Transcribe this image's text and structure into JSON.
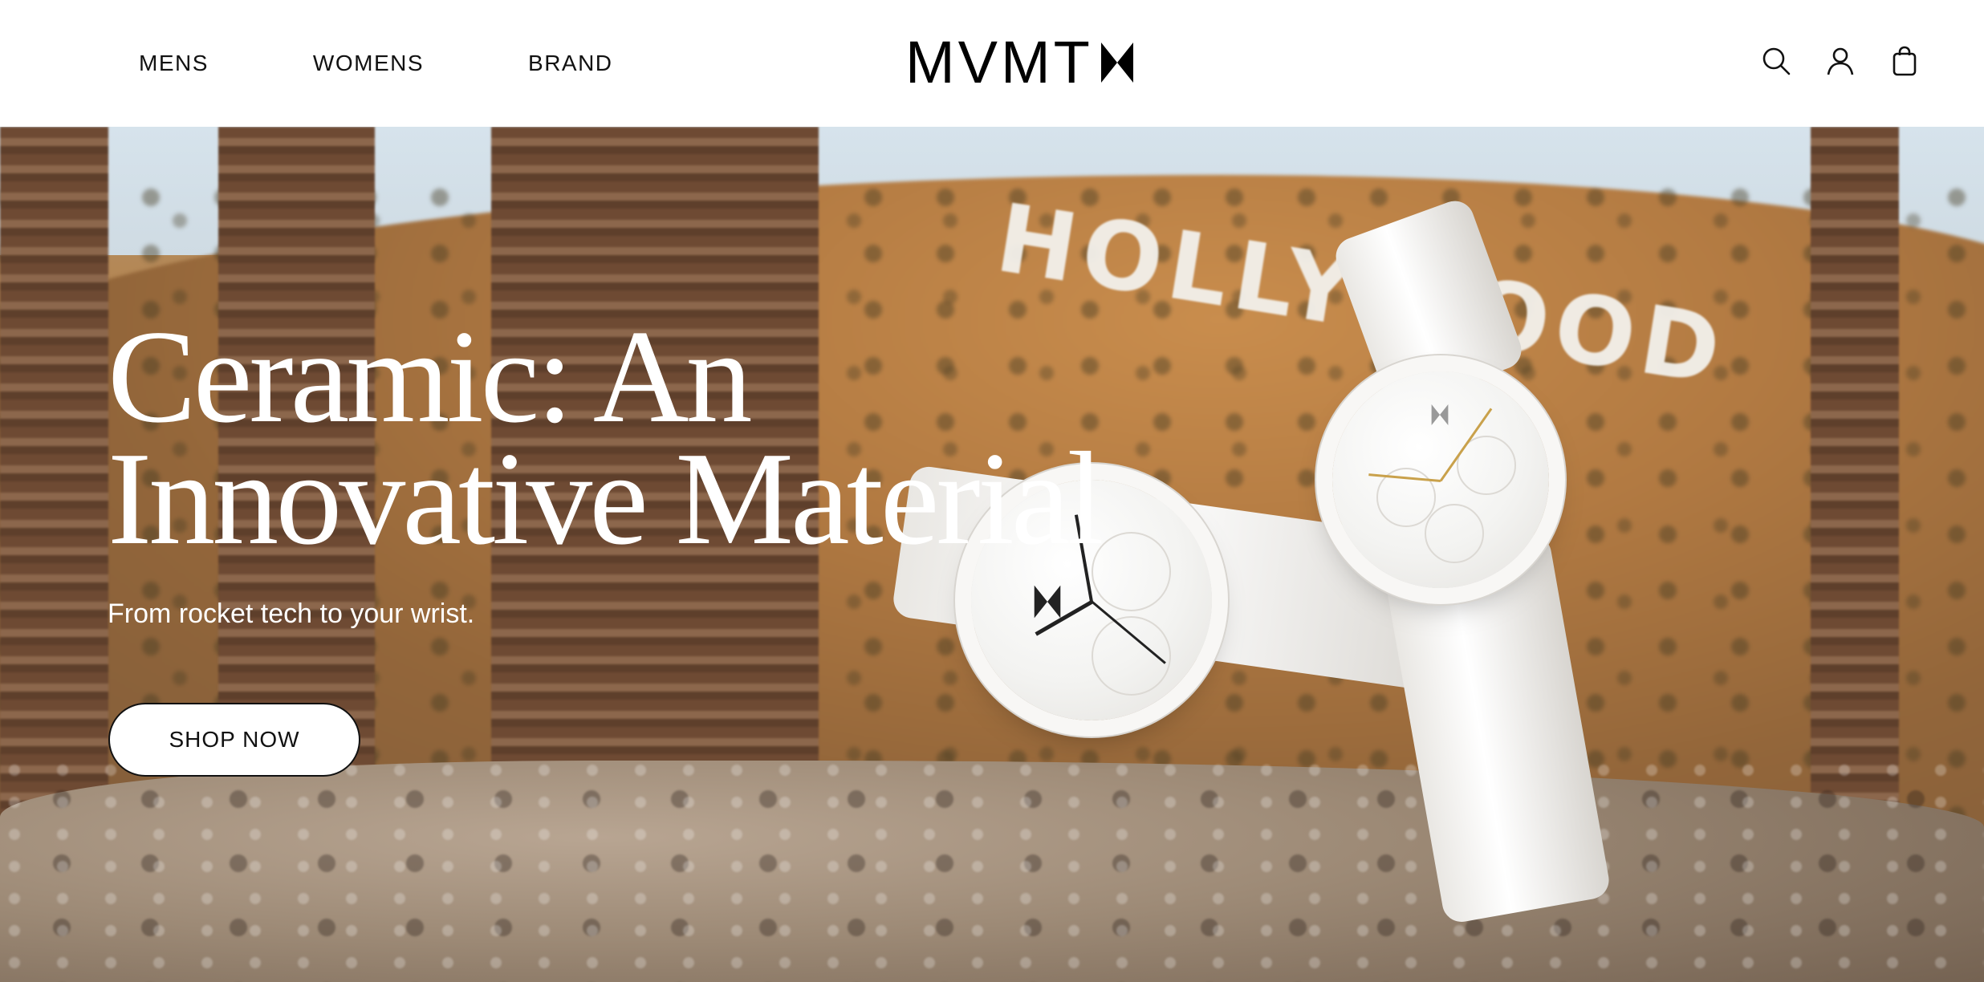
{
  "header": {
    "nav": [
      {
        "label": "MENS"
      },
      {
        "label": "WOMENS"
      },
      {
        "label": "BRAND"
      }
    ],
    "logo_text": "MVMT",
    "icons": [
      "search-icon",
      "account-icon",
      "shopping-bag-icon"
    ]
  },
  "hero": {
    "background_sign": "HOLLYWOOD",
    "title_line1": "Ceramic: An",
    "title_line2": "Innovative Material",
    "subtitle": "From rocket tech to your wrist.",
    "cta_label": "SHOP NOW"
  },
  "colors": {
    "text_dark": "#111111",
    "hero_text": "#ffffff",
    "button_bg": "#ffffff"
  }
}
